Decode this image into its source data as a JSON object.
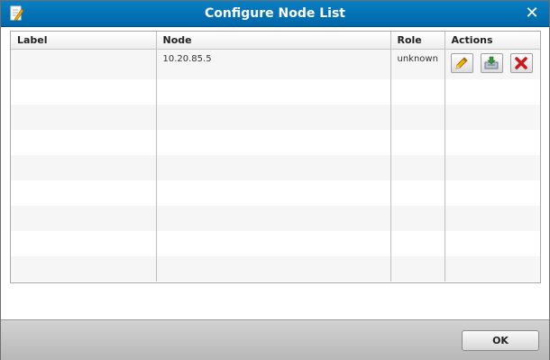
{
  "dialog": {
    "title": "Configure Node List",
    "title_icon": "edit-document-icon",
    "close_icon": "close-icon",
    "close_glyph": "✕"
  },
  "table": {
    "columns": [
      "Label",
      "Node",
      "Role",
      "Actions"
    ],
    "rows": [
      {
        "label": "",
        "node": "10.20.85.5",
        "role": "unknown",
        "actions": [
          "edit-pencil-icon",
          "download-tray-icon",
          "delete-x-icon"
        ]
      }
    ]
  },
  "footer": {
    "ok_label": "OK"
  }
}
